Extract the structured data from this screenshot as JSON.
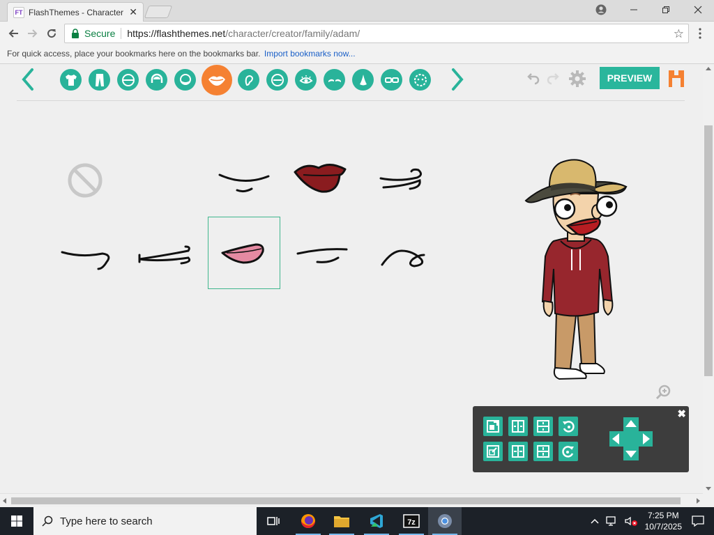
{
  "browser": {
    "tab_title": "FlashThemes - Character",
    "tab_favicon_text": "FT",
    "secure_label": "Secure",
    "url_host": "https://flashthemes.net",
    "url_path": "/character/creator/family/adam/",
    "bookmarks_hint": "For quick access, place your bookmarks here on the bookmarks bar.",
    "import_bookmarks": "Import bookmarks now..."
  },
  "editor": {
    "preview_label": "PREVIEW",
    "categories": [
      "shirt",
      "pants",
      "face-shape",
      "hair",
      "facial-hair",
      "mouth",
      "ear",
      "eye-shape",
      "eye",
      "eyebrow",
      "nose",
      "glasses",
      "mask"
    ],
    "active_category": "mouth",
    "mouth_options": [
      "none",
      "smirk-line",
      "dark-red-lips",
      "curl-line",
      "hook-line",
      "wide-line",
      "pink-lips",
      "flat-line",
      "wave-line"
    ],
    "selected_mouth": "pink-lips",
    "accent_color": "#29b39a",
    "active_color": "#f58132"
  },
  "transform_panel": {
    "close_glyph": "✖",
    "buttons": [
      "scale-up",
      "stretch-horizontal",
      "stretch-vertical",
      "rotate-left",
      "scale-down",
      "shrink-horizontal",
      "shrink-vertical",
      "rotate-right"
    ]
  },
  "taskbar": {
    "search_placeholder": "Type here to search",
    "time": "7:25 PM",
    "date": "10/7/2025"
  }
}
